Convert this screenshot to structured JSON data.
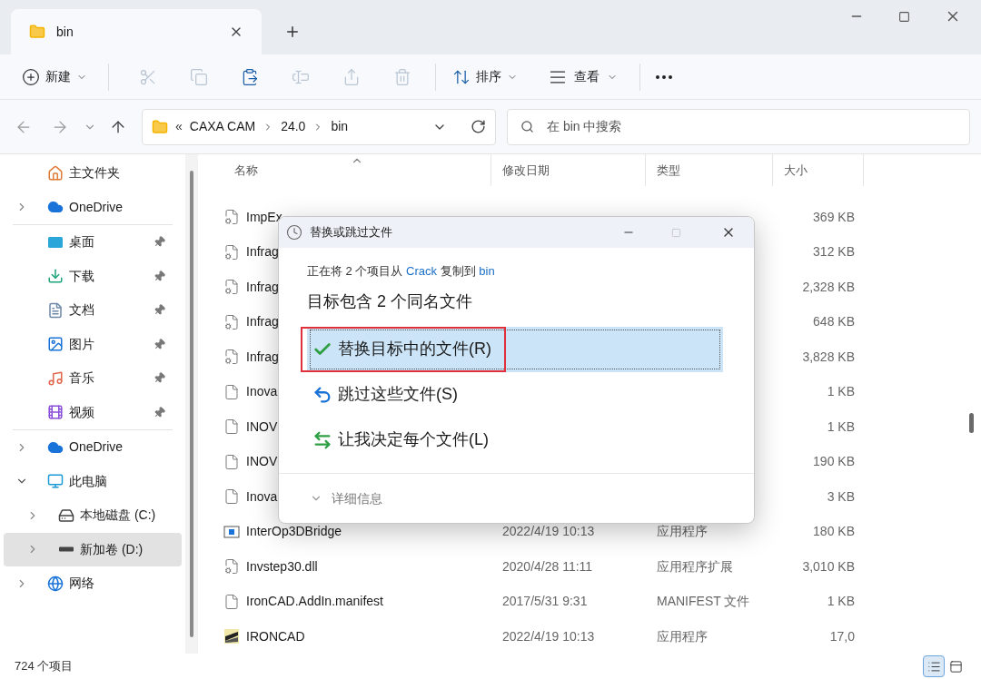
{
  "window": {
    "tab": {
      "title": "bin"
    }
  },
  "toolbar": {
    "new": {
      "label": "新建"
    },
    "actions": [
      {
        "kind": "cut",
        "disabled": true
      },
      {
        "kind": "copy",
        "disabled": true
      },
      {
        "kind": "paste",
        "disabled": false
      },
      {
        "kind": "rename",
        "disabled": true
      },
      {
        "kind": "share",
        "disabled": true
      },
      {
        "kind": "delete",
        "disabled": true
      }
    ],
    "sort": {
      "label": "排序"
    },
    "view": {
      "label": "查看"
    }
  },
  "address": {
    "overflow": "«",
    "segments": [
      "CAXA CAM",
      "24.0",
      "bin"
    ]
  },
  "search": {
    "placeholder": "在 bin 中搜索"
  },
  "sidebar": {
    "groups": [
      [
        {
          "kind": "home",
          "label": "主文件夹",
          "selected": false
        },
        {
          "kind": "cloud",
          "label": "OneDrive",
          "expanded": false,
          "selected": false
        }
      ],
      [
        {
          "kind": "desktop",
          "label": "桌面",
          "pinned": true,
          "selected": false
        },
        {
          "kind": "downloads",
          "label": "下载",
          "pinned": true,
          "selected": false
        },
        {
          "kind": "documents",
          "label": "文档",
          "pinned": true,
          "selected": false
        },
        {
          "kind": "pictures",
          "label": "图片",
          "pinned": true,
          "selected": false
        },
        {
          "kind": "music",
          "label": "音乐",
          "pinned": true,
          "selected": false
        },
        {
          "kind": "videos",
          "label": "视频",
          "pinned": true,
          "selected": false
        }
      ],
      [
        {
          "kind": "cloud",
          "label": "OneDrive",
          "expanded": false,
          "selected": false
        },
        {
          "kind": "pc",
          "label": "此电脑",
          "expanded": true,
          "selected": false,
          "children": [
            {
              "kind": "drive-c",
              "label": "本地磁盘 (C:)",
              "expanded": false,
              "selected": false
            },
            {
              "kind": "drive",
              "label": "新加卷 (D:)",
              "expanded": false,
              "selected": true
            }
          ]
        },
        {
          "kind": "network",
          "label": "网络",
          "expanded": false,
          "selected": false
        }
      ]
    ]
  },
  "table": {
    "columns": [
      {
        "label": "名称",
        "sorted": true
      },
      {
        "label": "修改日期",
        "sorted": false
      },
      {
        "label": "类型",
        "sorted": false
      },
      {
        "label": "大小",
        "sorted": false
      }
    ],
    "rows": [
      {
        "kind": "dll",
        "name": "ImpEx",
        "size": "369 KB"
      },
      {
        "kind": "dll",
        "name": "Infrag",
        "size": "312 KB"
      },
      {
        "kind": "dll",
        "name": "Infrag",
        "size": "2,328 KB"
      },
      {
        "kind": "dll",
        "name": "Infrag",
        "size": "648 KB"
      },
      {
        "kind": "dll",
        "name": "Infrag",
        "size": "3,828 KB"
      },
      {
        "kind": "file",
        "name": "Inova",
        "size": "1 KB"
      },
      {
        "kind": "file",
        "name": "INOV",
        "size": "1 KB"
      },
      {
        "kind": "file",
        "name": "INOV",
        "size": "190 KB"
      },
      {
        "kind": "file",
        "name": "Inova",
        "size": "3 KB"
      },
      {
        "kind": "app",
        "name": "InterOp3DBridge",
        "date": "2022/4/19 10:13",
        "type": "应用程序",
        "size": "180 KB"
      },
      {
        "kind": "dll",
        "name": "Invstep30.dll",
        "date": "2020/4/28 11:11",
        "type": "应用程序扩展",
        "size": "3,010 KB"
      },
      {
        "kind": "file",
        "name": "IronCAD.AddIn.manifest",
        "date": "2017/5/31 9:31",
        "type": "MANIFEST 文件",
        "size": "1 KB"
      },
      {
        "kind": "ironcad",
        "name": "IRONCAD",
        "date": "2022/4/19 10:13",
        "type": "应用程序",
        "size": "17,0"
      }
    ]
  },
  "dialog": {
    "title": "替换或跳过文件",
    "message": [
      {
        "kind": "text",
        "text": "正在将 2 个项目从 "
      },
      {
        "kind": "link",
        "text": "Crack"
      },
      {
        "kind": "text",
        "text": " 复制到 "
      },
      {
        "kind": "link",
        "text": "bin"
      }
    ],
    "heading": "目标包含 2 个同名文件",
    "options": [
      {
        "kind": "replace",
        "label": "替换目标中的文件(R)",
        "selected": true,
        "outlined": true
      },
      {
        "kind": "skip",
        "label": "跳过这些文件(S)",
        "selected": false,
        "outlined": false
      },
      {
        "kind": "decide",
        "label": "让我决定每个文件(L)",
        "selected": false,
        "outlined": false
      }
    ],
    "details": "详细信息"
  },
  "status_bar": {
    "count": "724 个项目",
    "views": [
      {
        "kind": "details",
        "selected": true
      },
      {
        "kind": "tiles",
        "selected": false
      }
    ]
  }
}
